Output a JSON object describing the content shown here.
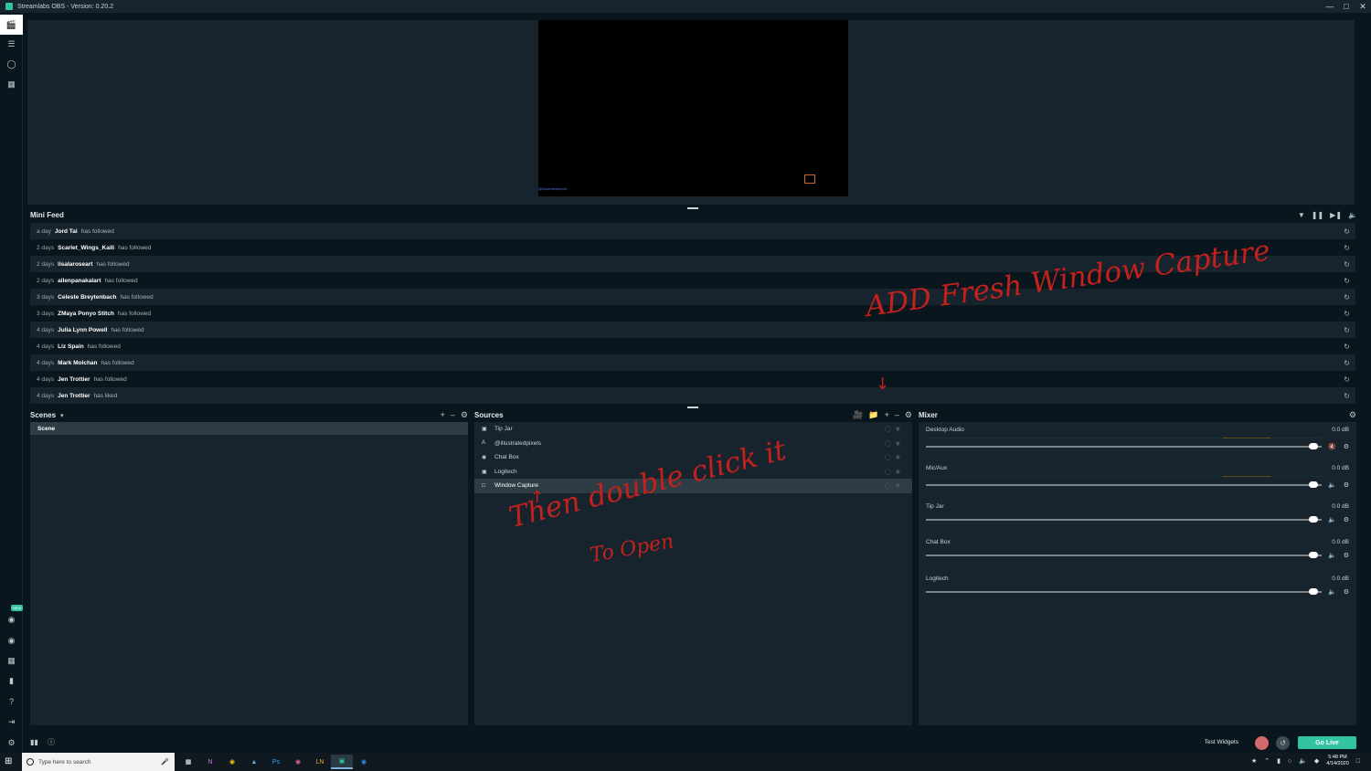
{
  "window": {
    "title": "Streamlabs OBS - Version: 0.20.2"
  },
  "preview": {
    "watermark": "@illustratedpixels"
  },
  "minifeed": {
    "title": "Mini Feed",
    "items": [
      {
        "ago": "a day",
        "user": "Jord Tai",
        "action": "has followed"
      },
      {
        "ago": "2 days",
        "user": "Scarlet_Wings_Kaili",
        "action": "has followed"
      },
      {
        "ago": "2 days",
        "user": "lisalaroseart",
        "action": "has followed"
      },
      {
        "ago": "2 days",
        "user": "allenpanakalart",
        "action": "has followed"
      },
      {
        "ago": "3 days",
        "user": "Celeste Breytenbach",
        "action": "has followed"
      },
      {
        "ago": "3 days",
        "user": "ZMaya Ponyo Stitch",
        "action": "has followed"
      },
      {
        "ago": "4 days",
        "user": "Julia Lynn Powell",
        "action": "has followed"
      },
      {
        "ago": "4 days",
        "user": "Liz Spain",
        "action": "has followed"
      },
      {
        "ago": "4 days",
        "user": "Mark Molchan",
        "action": "has followed"
      },
      {
        "ago": "4 days",
        "user": "Jen Trottier",
        "action": "has followed"
      },
      {
        "ago": "4 days",
        "user": "Jen Trottier",
        "action": "has liked"
      }
    ]
  },
  "scenes": {
    "title": "Scenes",
    "items": [
      "Scene"
    ]
  },
  "sources": {
    "title": "Sources",
    "items": [
      {
        "label": "Tip Jar",
        "icon": "image-icon"
      },
      {
        "label": "@illustratedpixels",
        "icon": "text-icon"
      },
      {
        "label": "Chat Box",
        "icon": "chat-icon"
      },
      {
        "label": "Logitech",
        "icon": "camera-icon"
      },
      {
        "label": "Window Capture",
        "icon": "window-icon",
        "selected": true
      }
    ]
  },
  "mixer": {
    "title": "Mixer",
    "channels": [
      {
        "name": "Desktop Audio",
        "level": "0.0 dB"
      },
      {
        "name": "Mic/Aux",
        "level": "0.0 dB"
      },
      {
        "name": "Tip Jar",
        "level": "0.0 dB"
      },
      {
        "name": "Chat Box",
        "level": "0.0 dB"
      },
      {
        "name": "Logitech",
        "level": "0.0 dB"
      }
    ]
  },
  "footer": {
    "test_widgets": "Test Widgets",
    "go_live": "Go Live"
  },
  "taskbar": {
    "search_placeholder": "Type here to search",
    "time": "5:48 PM",
    "date": "4/14/2020"
  },
  "annotations": {
    "add": "ADD Fresh Window Capture",
    "double_click": "Then double click it",
    "to_open": "To Open"
  },
  "colors": {
    "accent": "#31c3a2",
    "panel": "#17242d",
    "background": "#09161d",
    "annotation": "#c4211d"
  }
}
